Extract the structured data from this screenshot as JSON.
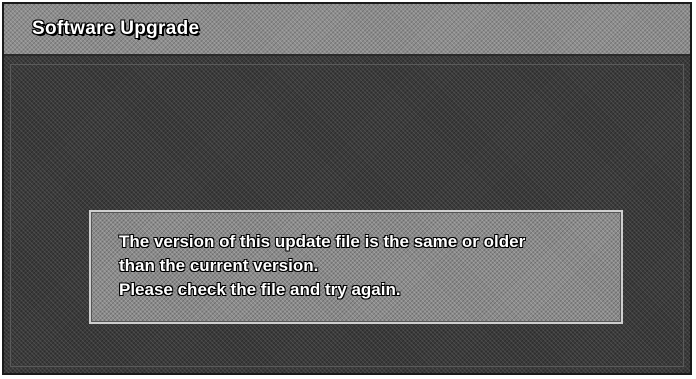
{
  "window": {
    "title": "Software Upgrade"
  },
  "dialog": {
    "lines": [
      "The version of this update file is the same or older",
      "than the current version.",
      "Please check the file and try again."
    ]
  }
}
